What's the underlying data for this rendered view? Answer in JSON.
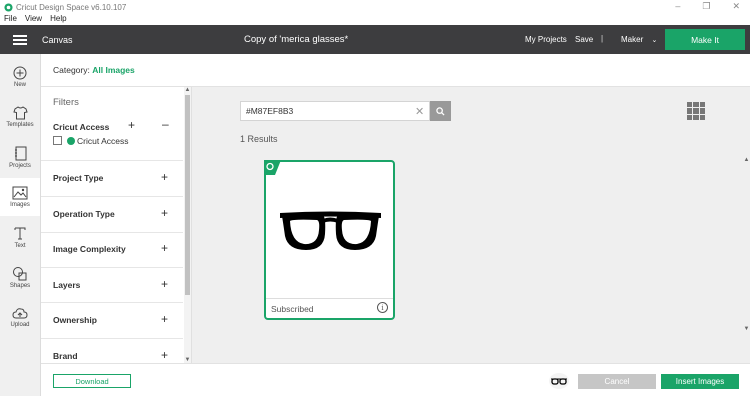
{
  "window": {
    "title": "Cricut Design Space  v6.10.107",
    "menu": [
      "File",
      "View",
      "Help"
    ]
  },
  "header": {
    "section": "Canvas",
    "project_title": "Copy of 'merica glasses*",
    "my_projects": "My Projects",
    "save": "Save",
    "separator": "|",
    "machine": "Maker",
    "make_it": "Make It"
  },
  "nav": [
    {
      "label": "New",
      "icon": "plus-circle-icon"
    },
    {
      "label": "Templates",
      "icon": "shirt-icon"
    },
    {
      "label": "Projects",
      "icon": "notebook-icon"
    },
    {
      "label": "Images",
      "icon": "image-icon",
      "active": true
    },
    {
      "label": "Text",
      "icon": "text-icon"
    },
    {
      "label": "Shapes",
      "icon": "shapes-icon"
    },
    {
      "label": "Upload",
      "icon": "cloud-upload-icon"
    }
  ],
  "category": {
    "label": "Category:",
    "value": "All Images"
  },
  "filters": {
    "title": "Filters",
    "cricut_access": {
      "heading": "Cricut Access",
      "checkbox_label": "Cricut Access"
    },
    "sections": [
      "Project Type",
      "Operation Type",
      "Image Complexity",
      "Layers",
      "Ownership",
      "Brand"
    ]
  },
  "search": {
    "value": "#M87EF8B3",
    "placeholder": "Search"
  },
  "results": {
    "count_text": "1 Results",
    "items": [
      {
        "status": "Subscribed",
        "image": "glasses-icon"
      }
    ]
  },
  "footer": {
    "download": "Download",
    "cancel": "Cancel",
    "insert": "Insert Images"
  },
  "colors": {
    "accent": "#1aa468",
    "header_bg": "#3d3d3f",
    "results_bg": "#efefef"
  }
}
